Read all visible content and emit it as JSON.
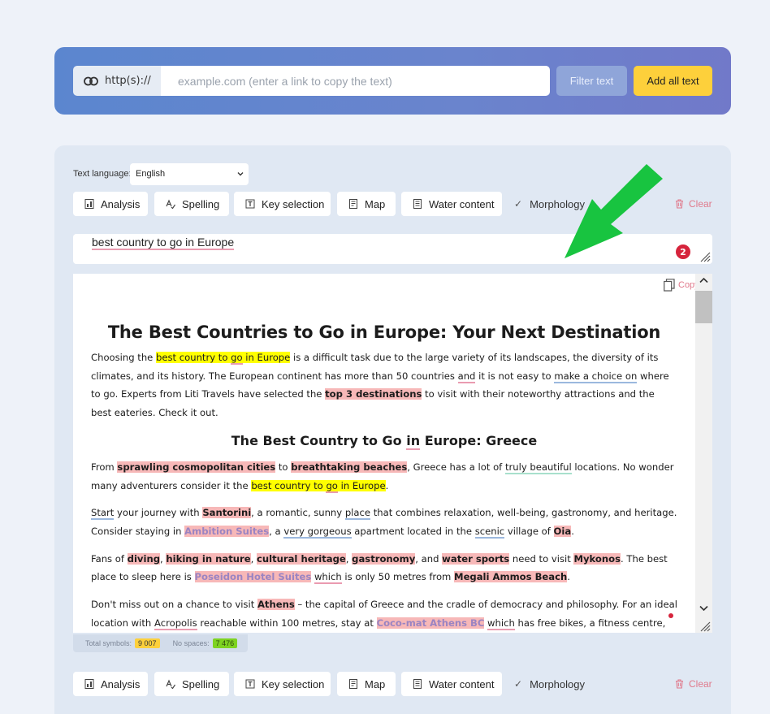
{
  "url_bar": {
    "prefix": "http(s)://",
    "placeholder": "example.com (enter a link to copy the text)",
    "filter_button": "Filter text",
    "add_all_button": "Add all text"
  },
  "language": {
    "label": "Text language:",
    "selected": "English"
  },
  "toolbar": {
    "analysis": "Analysis",
    "spelling": "Spelling",
    "key_selection": "Key selection",
    "map": "Map",
    "water_content": "Water content",
    "morphology": "Morphology",
    "clear": "Clear"
  },
  "keywords": {
    "text": "best country to go in Europe",
    "error_count": "2"
  },
  "editor": {
    "copy_label": "Copy",
    "title": "The Best Countries to Go in Europe: Your Next Destination",
    "heading2": "The Best Country to Go in Europe: Greece"
  },
  "stats": {
    "total_label": "Total symbols:",
    "total_value": "9 007",
    "nospace_label": "No spaces:",
    "nospace_value": "7 476"
  },
  "colors": {
    "accent_yellow": "#fdd03b",
    "arrow_green": "#18c440",
    "error_red": "#d6243c",
    "clear_pink": "#e0798b"
  }
}
